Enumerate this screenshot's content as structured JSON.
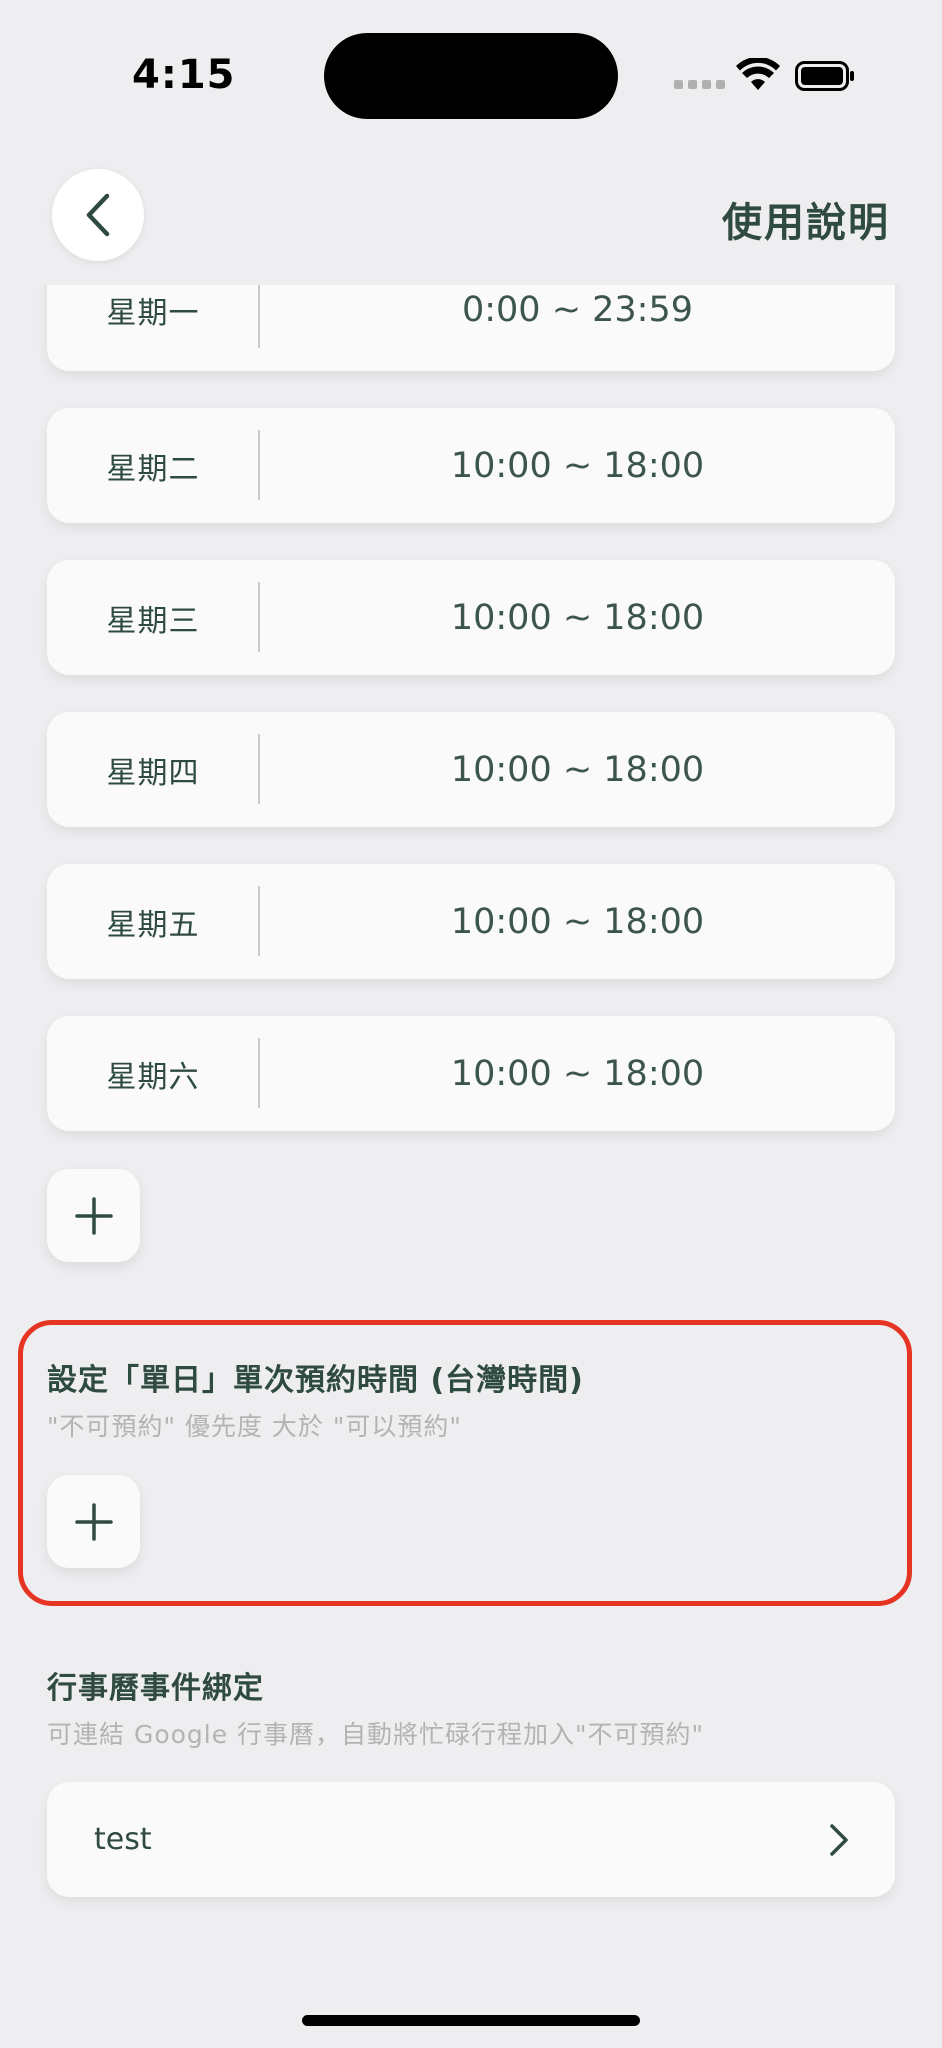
{
  "status_bar": {
    "time": "4:15"
  },
  "header": {
    "help_label": "使用說明",
    "back_icon": "chevron-left-icon"
  },
  "weekly_schedule": [
    {
      "day": "星期一",
      "time": "0:00 ~ 23:59"
    },
    {
      "day": "星期二",
      "time": "10:00 ~ 18:00"
    },
    {
      "day": "星期三",
      "time": "10:00 ~ 18:00"
    },
    {
      "day": "星期四",
      "time": "10:00 ~ 18:00"
    },
    {
      "day": "星期五",
      "time": "10:00 ~ 18:00"
    },
    {
      "day": "星期六",
      "time": "10:00 ~ 18:00"
    }
  ],
  "single_day_section": {
    "title": "設定「單日」單次預約時間 (台灣時間)",
    "subtitle": "\"不可預約\" 優先度 大於 \"可以預約\""
  },
  "calendar_section": {
    "title": "行事曆事件綁定",
    "subtitle": "可連結 Google 行事曆，自動將忙碌行程加入\"不可預約\"",
    "calendar_name": "test"
  },
  "colors": {
    "background": "#EEEEF0",
    "card": "#FAFAFA",
    "text_primary": "#2F4A3E",
    "text_muted": "#B2B4B3",
    "highlight": "#E53422"
  }
}
